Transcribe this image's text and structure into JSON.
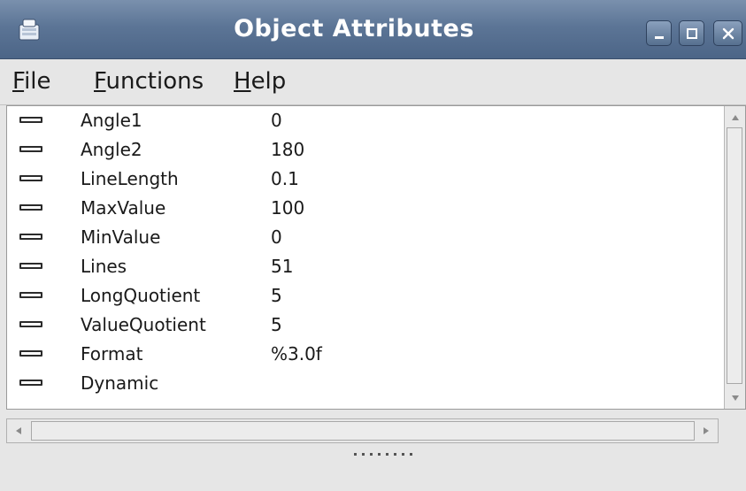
{
  "window": {
    "title": "Object Attributes",
    "icon": "app-icon",
    "controls": [
      "minimize-icon",
      "maximize-icon",
      "close-icon"
    ]
  },
  "menu": {
    "file": {
      "mnemonic": "F",
      "rest": "ile"
    },
    "functions": {
      "mnemonic": "F",
      "rest": "unctions"
    },
    "help": {
      "mnemonic": "H",
      "rest": "elp"
    }
  },
  "attributes": [
    {
      "name": "Angle1",
      "value": "0"
    },
    {
      "name": "Angle2",
      "value": "180"
    },
    {
      "name": "LineLength",
      "value": "0.1"
    },
    {
      "name": "MaxValue",
      "value": "100"
    },
    {
      "name": "MinValue",
      "value": "0"
    },
    {
      "name": "Lines",
      "value": "51"
    },
    {
      "name": "LongQuotient",
      "value": "5"
    },
    {
      "name": "ValueQuotient",
      "value": "5"
    },
    {
      "name": "Format",
      "value": "%3.0f"
    },
    {
      "name": "Dynamic",
      "value": ""
    }
  ],
  "colors": {
    "titlebar": "#5c7596",
    "background": "#e6e6e6",
    "list_background": "#ffffff"
  }
}
